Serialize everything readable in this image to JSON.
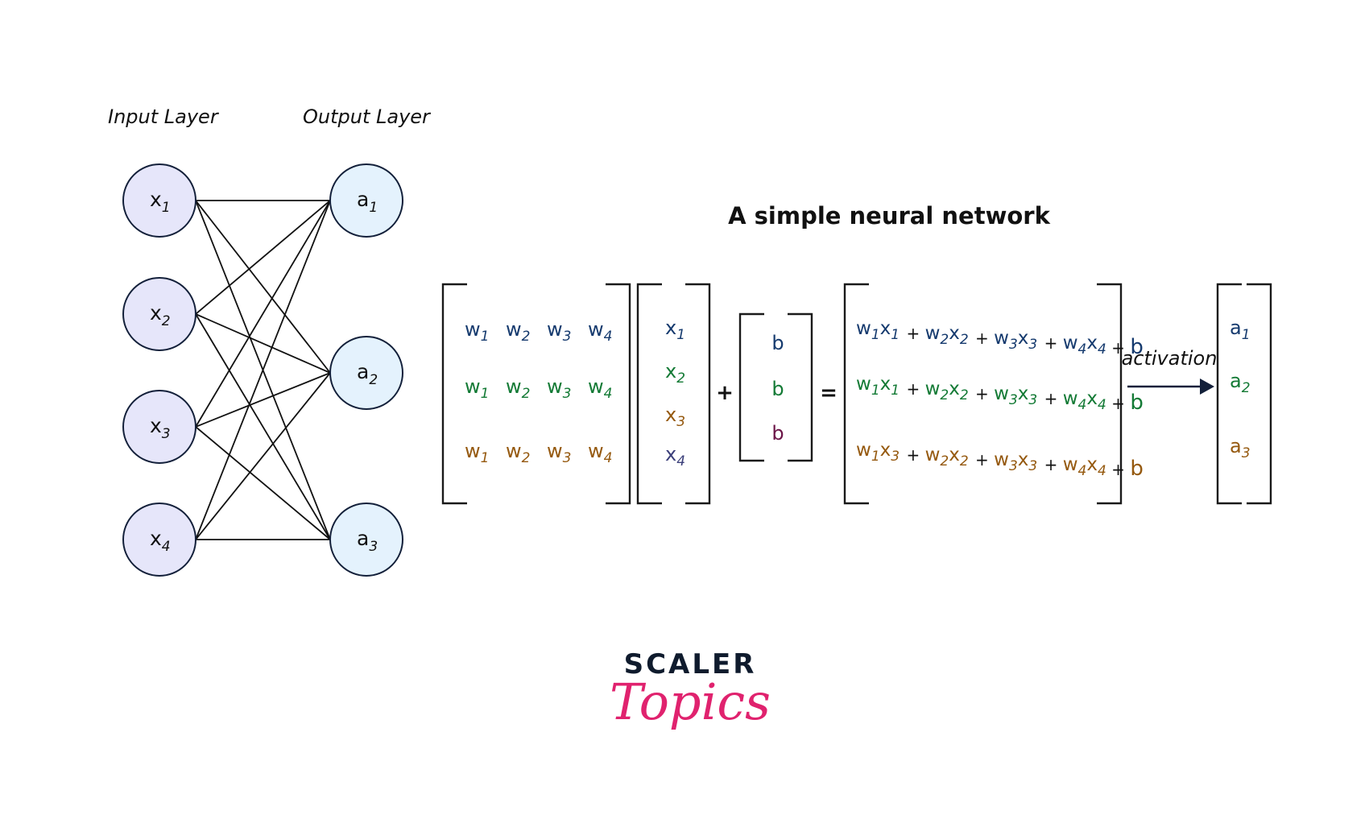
{
  "title": "A simple neural network",
  "labels": {
    "input_layer": "Input Layer",
    "output_layer": "Output Layer",
    "activation": "activation"
  },
  "colors": {
    "row1": "#153a6e",
    "row2": "#137a35",
    "row3": "#95590f",
    "x4": "#3b3f7a",
    "b3": "#6b1447",
    "input_node_fill": "#e6e6fa",
    "output_node_fill": "#e4f2fd",
    "node_stroke": "#13203a",
    "logo_dark": "#0f1b2d",
    "logo_pink": "#e0226e"
  },
  "input_nodes": [
    {
      "base": "x",
      "sub": "1"
    },
    {
      "base": "x",
      "sub": "2"
    },
    {
      "base": "x",
      "sub": "3"
    },
    {
      "base": "x",
      "sub": "4"
    }
  ],
  "output_nodes": [
    {
      "base": "a",
      "sub": "1"
    },
    {
      "base": "a",
      "sub": "2"
    },
    {
      "base": "a",
      "sub": "3"
    }
  ],
  "connections": "fully-connected (each of 4 inputs to each of 3 outputs)",
  "weight_matrix": {
    "rows": [
      {
        "color_key": "row1",
        "cells": [
          {
            "base": "w",
            "sub": "1"
          },
          {
            "base": "w",
            "sub": "2"
          },
          {
            "base": "w",
            "sub": "3"
          },
          {
            "base": "w",
            "sub": "4"
          }
        ]
      },
      {
        "color_key": "row2",
        "cells": [
          {
            "base": "w",
            "sub": "1"
          },
          {
            "base": "w",
            "sub": "2"
          },
          {
            "base": "w",
            "sub": "3"
          },
          {
            "base": "w",
            "sub": "4"
          }
        ]
      },
      {
        "color_key": "row3",
        "cells": [
          {
            "base": "w",
            "sub": "1"
          },
          {
            "base": "w",
            "sub": "2"
          },
          {
            "base": "w",
            "sub": "3"
          },
          {
            "base": "w",
            "sub": "4"
          }
        ]
      }
    ]
  },
  "input_vector": [
    {
      "base": "x",
      "sub": "1",
      "color_key": "row1"
    },
    {
      "base": "x",
      "sub": "2",
      "color_key": "row2"
    },
    {
      "base": "x",
      "sub": "3",
      "color_key": "row3"
    },
    {
      "base": "x",
      "sub": "4",
      "color_key": "x4"
    }
  ],
  "operators": {
    "plus": "+",
    "equals": "="
  },
  "bias_vector": [
    {
      "text": "b",
      "color_key": "row1"
    },
    {
      "text": "b",
      "color_key": "row2"
    },
    {
      "text": "b",
      "color_key": "b3"
    }
  ],
  "result_rows": [
    {
      "color_key": "row1",
      "terms": [
        [
          "w",
          "1",
          "x",
          "1"
        ],
        [
          "w",
          "2",
          "x",
          "2"
        ],
        [
          "w",
          "3",
          "x",
          "3"
        ],
        [
          "w",
          "4",
          "x",
          "4"
        ]
      ],
      "bias": "b"
    },
    {
      "color_key": "row2",
      "terms": [
        [
          "w",
          "1",
          "x",
          "1"
        ],
        [
          "w",
          "2",
          "x",
          "2"
        ],
        [
          "w",
          "3",
          "x",
          "3"
        ],
        [
          "w",
          "4",
          "x",
          "4"
        ]
      ],
      "bias": "b"
    },
    {
      "color_key": "row3",
      "terms": [
        [
          "w",
          "1",
          "x",
          "3"
        ],
        [
          "w",
          "2",
          "x",
          "2"
        ],
        [
          "w",
          "3",
          "x",
          "3"
        ],
        [
          "w",
          "4",
          "x",
          "4"
        ]
      ],
      "bias": "b"
    }
  ],
  "output_vector": [
    {
      "base": "a",
      "sub": "1",
      "color_key": "row1"
    },
    {
      "base": "a",
      "sub": "2",
      "color_key": "row2"
    },
    {
      "base": "a",
      "sub": "3",
      "color_key": "row3"
    }
  ],
  "logo": {
    "top": "SCALER",
    "bottom": "Topics"
  }
}
